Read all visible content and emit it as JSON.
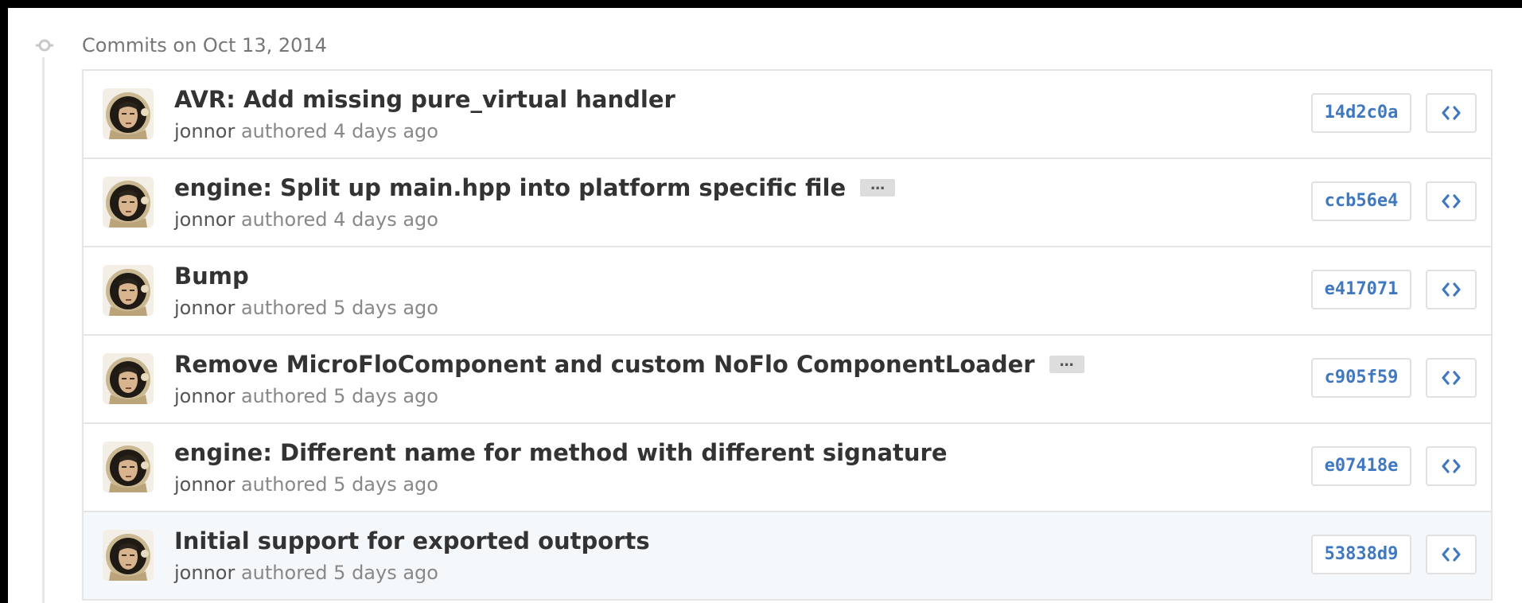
{
  "group": {
    "title": "Commits on Oct 13, 2014"
  },
  "commits": [
    {
      "message": "AVR: Add missing pure_virtual handler",
      "author": "jonnor",
      "action": "authored",
      "time": "4 days ago",
      "sha": "14d2c0a",
      "has_more": false
    },
    {
      "message": "engine: Split up main.hpp into platform specific file",
      "author": "jonnor",
      "action": "authored",
      "time": "4 days ago",
      "sha": "ccb56e4",
      "has_more": true,
      "more_label": "…"
    },
    {
      "message": "Bump",
      "author": "jonnor",
      "action": "authored",
      "time": "5 days ago",
      "sha": "e417071",
      "has_more": false
    },
    {
      "message": "Remove MicroFloComponent and custom NoFlo ComponentLoader",
      "author": "jonnor",
      "action": "authored",
      "time": "5 days ago",
      "sha": "c905f59",
      "has_more": true,
      "more_label": "…"
    },
    {
      "message": "engine: Different name for method with different signature",
      "author": "jonnor",
      "action": "authored",
      "time": "5 days ago",
      "sha": "e07418e",
      "has_more": false
    },
    {
      "message": "Initial support for exported outports",
      "author": "jonnor",
      "action": "authored",
      "time": "5 days ago",
      "sha": "53838d9",
      "has_more": false
    }
  ],
  "icons": {
    "timeline": "git-commit-icon",
    "browse": "code-icon",
    "avatar": "astronaut-avatar"
  },
  "colors": {
    "sha_link": "#4078c0",
    "title_text": "#333333",
    "meta_text": "#888888",
    "highlight_row": "#f4f8fb"
  }
}
